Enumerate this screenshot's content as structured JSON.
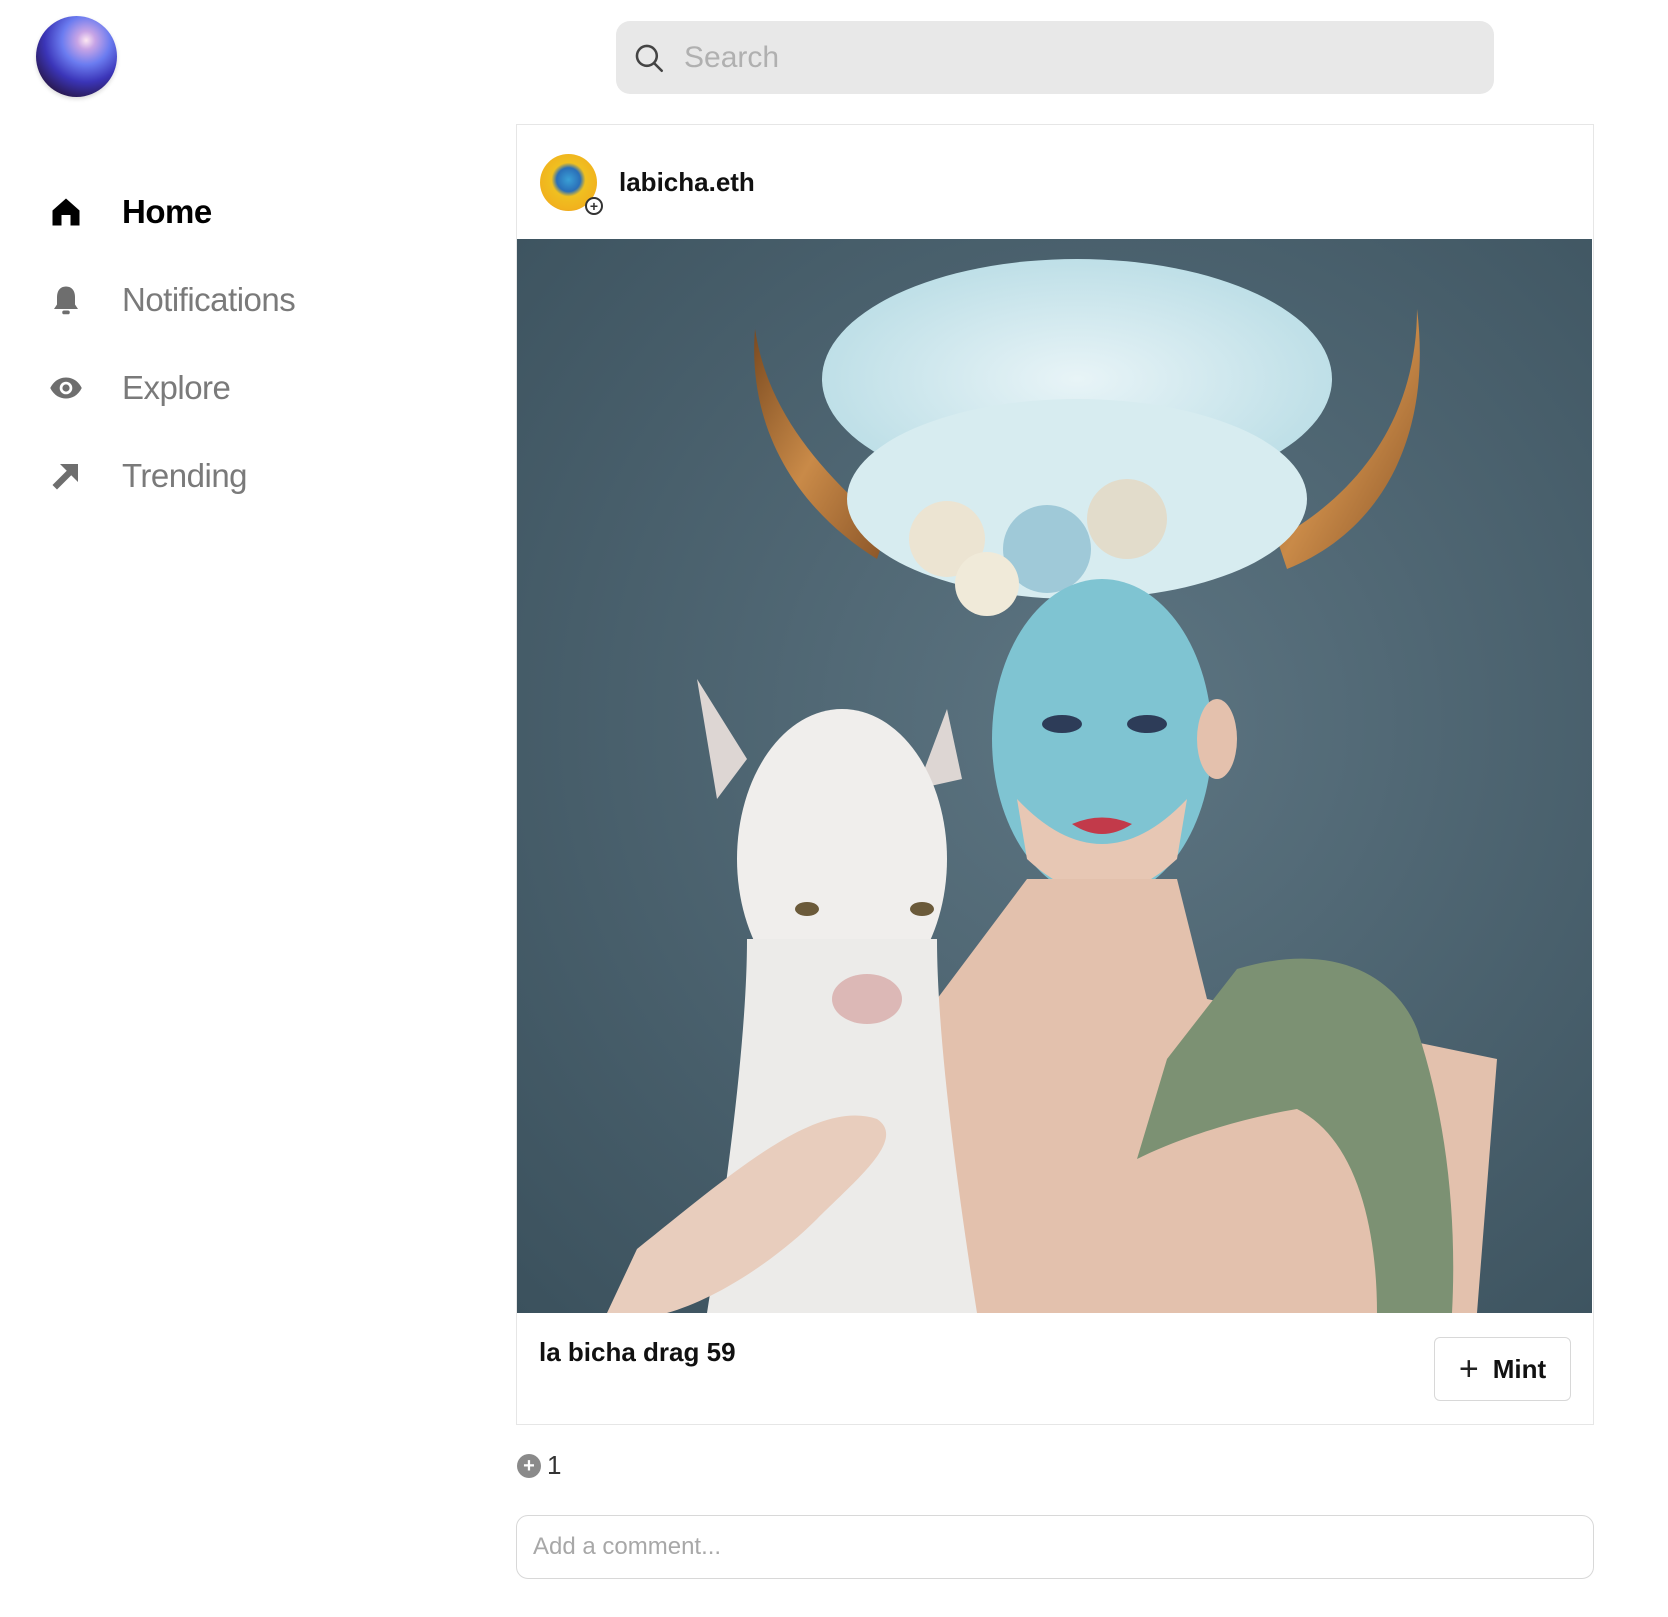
{
  "nav": {
    "items": [
      {
        "label": "Home",
        "icon": "home-icon",
        "active": true
      },
      {
        "label": "Notifications",
        "icon": "bell-icon",
        "active": false
      },
      {
        "label": "Explore",
        "icon": "eye-icon",
        "active": false
      },
      {
        "label": "Trending",
        "icon": "arrow-up-right-icon",
        "active": false
      }
    ]
  },
  "search": {
    "placeholder": "Search"
  },
  "post": {
    "username": "labicha.eth",
    "title": "la bicha drag 59",
    "mint_label": "Mint",
    "mint_icon": "plus-icon",
    "image_alt": "Drag performer with blue face paint, white wig with horns and flowers, holding a white goat"
  },
  "stats": {
    "count": "1",
    "icon": "plus-circle-icon"
  },
  "comment": {
    "placeholder": "Add a comment..."
  },
  "colors": {
    "background": "#ffffff",
    "search_bg": "#e8e8e8",
    "text_muted": "#7a7a7a",
    "photo_bg": "#46606d"
  }
}
